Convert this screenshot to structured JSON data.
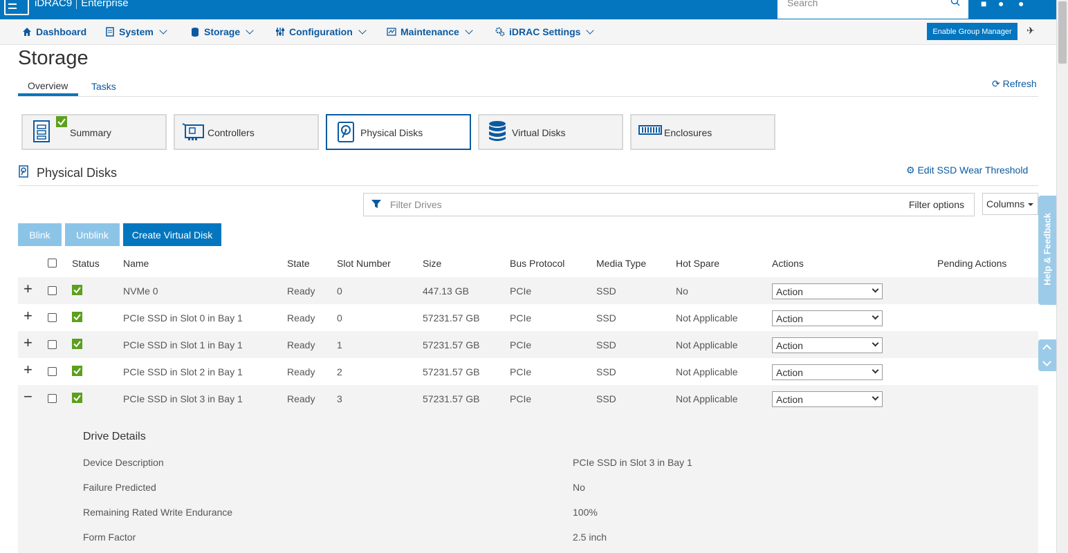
{
  "app": {
    "name": "iDRAC9",
    "edition": "Enterprise"
  },
  "search": {
    "placeholder": "Search"
  },
  "nav": {
    "items": [
      {
        "label": "Dashboard"
      },
      {
        "label": "System"
      },
      {
        "label": "Storage"
      },
      {
        "label": "Configuration"
      },
      {
        "label": "Maintenance"
      },
      {
        "label": "iDRAC Settings"
      }
    ],
    "enable_group_manager": "Enable Group Manager"
  },
  "page": {
    "title": "Storage",
    "tabs": [
      {
        "label": "Overview"
      },
      {
        "label": "Tasks"
      }
    ],
    "refresh": "Refresh"
  },
  "categories": [
    {
      "label": "Summary",
      "icon": "server-summary-icon"
    },
    {
      "label": "Controllers",
      "icon": "controller-card-icon"
    },
    {
      "label": "Physical Disks",
      "icon": "physical-disk-icon",
      "active": true
    },
    {
      "label": "Virtual Disks",
      "icon": "database-icon"
    },
    {
      "label": "Enclosures",
      "icon": "enclosure-icon"
    }
  ],
  "section": {
    "title": "Physical Disks",
    "edit_ssd": "Edit SSD Wear Threshold"
  },
  "filter": {
    "placeholder": "Filter Drives",
    "options": "Filter options",
    "columns": "Columns"
  },
  "buttons": {
    "blink": "Blink",
    "unblink": "Unblink",
    "create_vd": "Create Virtual Disk"
  },
  "table": {
    "headers": {
      "status": "Status",
      "name": "Name",
      "state": "State",
      "slot": "Slot Number",
      "size": "Size",
      "bus": "Bus Protocol",
      "media": "Media Type",
      "hotspare": "Hot Spare",
      "actions": "Actions",
      "pending": "Pending Actions"
    },
    "rows": [
      {
        "expander": "+",
        "name": "NVMe 0",
        "state": "Ready",
        "slot": "0",
        "size": "447.13 GB",
        "bus": "PCIe",
        "media": "SSD",
        "hotspare": "No",
        "action": "Action"
      },
      {
        "expander": "+",
        "name": "PCIe SSD in Slot 0 in Bay 1",
        "state": "Ready",
        "slot": "0",
        "size": "57231.57 GB",
        "bus": "PCIe",
        "media": "SSD",
        "hotspare": "Not Applicable",
        "action": "Action"
      },
      {
        "expander": "+",
        "name": "PCIe SSD in Slot 1 in Bay 1",
        "state": "Ready",
        "slot": "1",
        "size": "57231.57 GB",
        "bus": "PCIe",
        "media": "SSD",
        "hotspare": "Not Applicable",
        "action": "Action"
      },
      {
        "expander": "+",
        "name": "PCIe SSD in Slot 2 in Bay 1",
        "state": "Ready",
        "slot": "2",
        "size": "57231.57 GB",
        "bus": "PCIe",
        "media": "SSD",
        "hotspare": "Not Applicable",
        "action": "Action"
      },
      {
        "expander": "−",
        "name": "PCIe SSD in Slot 3 in Bay 1",
        "state": "Ready",
        "slot": "3",
        "size": "57231.57 GB",
        "bus": "PCIe",
        "media": "SSD",
        "hotspare": "Not Applicable",
        "action": "Action"
      }
    ]
  },
  "details": {
    "title": "Drive Details",
    "items": [
      {
        "label": "Device Description",
        "value": "PCIe SSD in Slot 3 in Bay 1"
      },
      {
        "label": "Failure Predicted",
        "value": "No"
      },
      {
        "label": "Remaining Rated Write Endurance",
        "value": "100%"
      },
      {
        "label": "Form Factor",
        "value": "2.5 inch"
      }
    ]
  },
  "help": {
    "label": "Help & Feedback"
  },
  "colors": {
    "brand": "#0376bf",
    "status_ok": "#5ca01d",
    "link": "#0b5aa0"
  }
}
